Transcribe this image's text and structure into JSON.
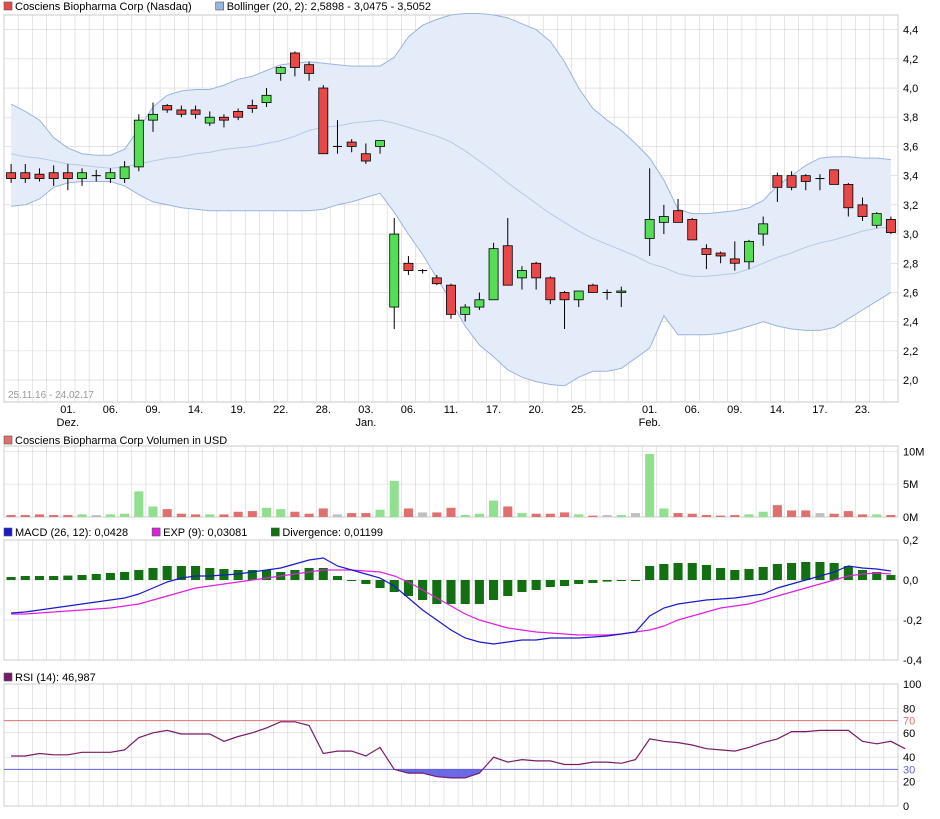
{
  "colors": {
    "up": "#55dd55",
    "down": "#e84848",
    "vol_up": "#90e090",
    "vol_down": "#e07070",
    "vol_neutral": "#c0c0c0",
    "band_fill": "#e4ecfa",
    "band_line": "#9bb4dc",
    "macd": "#1a1acc",
    "exp": "#e020e0",
    "divergence": "#127012",
    "rsi": "#7a1a6a",
    "rsi_70": "#e07070",
    "rsi_30": "#6060e0",
    "rsi_fill": "#5050e0",
    "grid": "#d4d4d4"
  },
  "chart_data": [
    {
      "type": "candlestick",
      "legend": [
        {
          "label": "Cosciens Biopharma Corp (Nasdaq)",
          "color": "#e84848"
        },
        {
          "label": "Bollinger (20, 2): 2,5898 - 3,0475 - 3,5052",
          "color": "#9bb4dc"
        }
      ],
      "date_range": "25.11.16 - 24.02.17",
      "ylim": [
        1.85,
        4.5
      ],
      "y_ticks": [
        "2,0",
        "2,2",
        "2,4",
        "2,6",
        "2,8",
        "3,0",
        "3,2",
        "3,4",
        "3,6",
        "3,8",
        "4,0",
        "4,2",
        "4,4"
      ],
      "x_ticks": [
        {
          "i": 4,
          "label": "01.",
          "sub": "Dez."
        },
        {
          "i": 7,
          "label": "06."
        },
        {
          "i": 10,
          "label": "09."
        },
        {
          "i": 13,
          "label": "14."
        },
        {
          "i": 16,
          "label": "19."
        },
        {
          "i": 19,
          "label": "22."
        },
        {
          "i": 22,
          "label": "28."
        },
        {
          "i": 25,
          "label": "03.",
          "sub": "Jan."
        },
        {
          "i": 28,
          "label": "06."
        },
        {
          "i": 31,
          "label": "11."
        },
        {
          "i": 34,
          "label": "17."
        },
        {
          "i": 37,
          "label": "20."
        },
        {
          "i": 40,
          "label": "25."
        },
        {
          "i": 45,
          "label": "01.",
          "sub": "Feb."
        },
        {
          "i": 48,
          "label": "06."
        },
        {
          "i": 51,
          "label": "09."
        },
        {
          "i": 54,
          "label": "14."
        },
        {
          "i": 57,
          "label": "17."
        },
        {
          "i": 60,
          "label": "23."
        }
      ],
      "ohlc": [
        [
          3.42,
          3.48,
          3.35,
          3.38
        ],
        [
          3.42,
          3.48,
          3.35,
          3.38
        ],
        [
          3.41,
          3.45,
          3.36,
          3.38
        ],
        [
          3.42,
          3.47,
          3.33,
          3.38
        ],
        [
          3.42,
          3.48,
          3.3,
          3.38
        ],
        [
          3.38,
          3.45,
          3.33,
          3.42
        ],
        [
          3.4,
          3.44,
          3.36,
          3.4
        ],
        [
          3.38,
          3.45,
          3.35,
          3.42
        ],
        [
          3.38,
          3.5,
          3.35,
          3.46
        ],
        [
          3.46,
          3.82,
          3.43,
          3.78
        ],
        [
          3.78,
          3.9,
          3.7,
          3.82
        ],
        [
          3.88,
          3.89,
          3.83,
          3.85
        ],
        [
          3.85,
          3.88,
          3.8,
          3.82
        ],
        [
          3.85,
          3.88,
          3.79,
          3.82
        ],
        [
          3.76,
          3.84,
          3.74,
          3.8
        ],
        [
          3.8,
          3.82,
          3.73,
          3.78
        ],
        [
          3.84,
          3.86,
          3.78,
          3.8
        ],
        [
          3.88,
          3.92,
          3.83,
          3.86
        ],
        [
          3.9,
          4.0,
          3.87,
          3.95
        ],
        [
          4.1,
          4.15,
          4.05,
          4.14
        ],
        [
          4.24,
          4.25,
          4.08,
          4.14
        ],
        [
          4.16,
          4.18,
          4.05,
          4.1
        ],
        [
          4.0,
          4.02,
          3.55,
          3.55
        ],
        [
          3.6,
          3.78,
          3.55,
          3.6
        ],
        [
          3.63,
          3.65,
          3.56,
          3.6
        ],
        [
          3.55,
          3.62,
          3.48,
          3.5
        ],
        [
          3.6,
          3.64,
          3.55,
          3.64
        ],
        [
          2.5,
          3.11,
          2.35,
          3.0
        ],
        [
          2.8,
          2.85,
          2.72,
          2.75
        ],
        [
          2.75,
          2.76,
          2.73,
          2.75
        ],
        [
          2.7,
          2.72,
          2.65,
          2.66
        ],
        [
          2.65,
          2.66,
          2.42,
          2.45
        ],
        [
          2.45,
          2.52,
          2.4,
          2.5
        ],
        [
          2.5,
          2.6,
          2.48,
          2.55
        ],
        [
          2.55,
          2.94,
          2.55,
          2.9
        ],
        [
          2.92,
          3.11,
          2.65,
          2.65
        ],
        [
          2.7,
          2.78,
          2.62,
          2.75
        ],
        [
          2.8,
          2.81,
          2.62,
          2.7
        ],
        [
          2.7,
          2.71,
          2.52,
          2.55
        ],
        [
          2.6,
          2.61,
          2.35,
          2.55
        ],
        [
          2.55,
          2.61,
          2.5,
          2.61
        ],
        [
          2.65,
          2.66,
          2.6,
          2.6
        ],
        [
          2.6,
          2.62,
          2.55,
          2.6
        ],
        [
          2.6,
          2.64,
          2.5,
          2.61
        ],
        null,
        [
          2.97,
          3.45,
          2.85,
          3.1
        ],
        [
          3.08,
          3.2,
          3.0,
          3.12
        ],
        [
          3.16,
          3.24,
          3.08,
          3.08
        ],
        [
          3.1,
          3.11,
          2.96,
          2.96
        ],
        [
          2.9,
          2.93,
          2.76,
          2.86
        ],
        [
          2.87,
          2.88,
          2.8,
          2.85
        ],
        [
          2.83,
          2.95,
          2.75,
          2.8
        ],
        [
          2.81,
          2.96,
          2.76,
          2.95
        ],
        [
          3.0,
          3.12,
          2.92,
          3.07
        ],
        [
          3.4,
          3.42,
          3.22,
          3.32
        ],
        [
          3.4,
          3.43,
          3.3,
          3.32
        ],
        [
          3.4,
          3.41,
          3.3,
          3.36
        ],
        [
          3.38,
          3.41,
          3.3,
          3.38
        ],
        [
          3.44,
          3.44,
          3.34,
          3.34
        ],
        [
          3.34,
          3.35,
          3.12,
          3.18
        ],
        [
          3.2,
          3.25,
          3.09,
          3.12
        ],
        [
          3.06,
          3.15,
          3.04,
          3.14
        ],
        [
          3.1,
          3.12,
          3.0,
          3.01
        ]
      ],
      "bollinger_upper": [
        3.89,
        3.84,
        3.78,
        3.66,
        3.59,
        3.55,
        3.54,
        3.54,
        3.58,
        3.72,
        3.87,
        3.95,
        3.98,
        3.99,
        3.99,
        4.02,
        4.06,
        4.08,
        4.12,
        4.16,
        4.17,
        4.18,
        4.17,
        4.16,
        4.15,
        4.15,
        4.15,
        4.21,
        4.35,
        4.43,
        4.47,
        4.5,
        4.51,
        4.51,
        4.5,
        4.48,
        4.44,
        4.4,
        4.32,
        4.18,
        4.0,
        3.86,
        3.78,
        3.71,
        3.62,
        3.52,
        3.37,
        3.17,
        3.14,
        3.14,
        3.15,
        3.16,
        3.18,
        3.23,
        3.33,
        3.4,
        3.47,
        3.52,
        3.53,
        3.53,
        3.52,
        3.52,
        3.51
      ],
      "bollinger_middle": [
        3.55,
        3.53,
        3.52,
        3.5,
        3.48,
        3.47,
        3.46,
        3.45,
        3.46,
        3.48,
        3.5,
        3.52,
        3.53,
        3.55,
        3.56,
        3.58,
        3.59,
        3.6,
        3.62,
        3.64,
        3.67,
        3.71,
        3.73,
        3.74,
        3.76,
        3.77,
        3.78,
        3.76,
        3.73,
        3.7,
        3.67,
        3.63,
        3.57,
        3.5,
        3.43,
        3.35,
        3.28,
        3.21,
        3.14,
        3.08,
        3.02,
        2.97,
        2.93,
        2.89,
        2.85,
        2.8,
        2.77,
        2.73,
        2.71,
        2.71,
        2.72,
        2.73,
        2.76,
        2.8,
        2.84,
        2.87,
        2.91,
        2.94,
        2.96,
        2.99,
        3.02,
        3.04,
        3.05
      ],
      "bollinger_lower": [
        3.19,
        3.2,
        3.24,
        3.32,
        3.35,
        3.36,
        3.36,
        3.36,
        3.33,
        3.27,
        3.22,
        3.2,
        3.18,
        3.17,
        3.16,
        3.16,
        3.16,
        3.16,
        3.16,
        3.16,
        3.16,
        3.16,
        3.17,
        3.2,
        3.22,
        3.25,
        3.28,
        3.15,
        3.0,
        2.86,
        2.7,
        2.54,
        2.37,
        2.24,
        2.16,
        2.07,
        2.02,
        1.99,
        1.97,
        1.96,
        2.02,
        2.06,
        2.06,
        2.08,
        2.15,
        2.22,
        2.44,
        2.31,
        2.31,
        2.31,
        2.32,
        2.34,
        2.37,
        2.4,
        2.37,
        2.35,
        2.34,
        2.34,
        2.36,
        2.42,
        2.48,
        2.54,
        2.6
      ]
    },
    {
      "type": "bar",
      "legend": [
        {
          "label": "Cosciens Biopharma Corp Volumen in USD",
          "color": "#e07070"
        }
      ],
      "ylim": [
        0,
        10.8
      ],
      "y_ticks": [
        {
          "v": 0,
          "label": "0M"
        },
        {
          "v": 5,
          "label": "5M"
        },
        {
          "v": 10,
          "label": "10M"
        }
      ],
      "volume_millions": [
        0.3,
        0.3,
        0.4,
        0.3,
        0.3,
        0.4,
        0.3,
        0.4,
        0.5,
        3.9,
        1.6,
        1.2,
        0.5,
        0.4,
        0.4,
        0.4,
        0.8,
        0.9,
        1.4,
        1.2,
        0.8,
        0.5,
        1.3,
        0.4,
        0.6,
        0.6,
        1.1,
        5.5,
        1.3,
        0.7,
        0.7,
        1.4,
        0.3,
        0.5,
        2.5,
        1.6,
        0.6,
        0.5,
        0.5,
        0.7,
        0.4,
        0.2,
        0.3,
        0.3,
        0.6,
        9.6,
        1.3,
        0.6,
        0.5,
        0.3,
        0.2,
        0.3,
        0.4,
        0.8,
        1.8,
        1.0,
        1.0,
        0.6,
        0.5,
        0.9,
        0.4,
        0.4,
        0.3
      ]
    },
    {
      "type": "bar+line",
      "legend": [
        {
          "label": "MACD (26, 12): 0,0428",
          "color": "#1a1acc"
        },
        {
          "label": "EXP (9): 0,03081",
          "color": "#e020e0"
        },
        {
          "label": "Divergence: 0,01199",
          "color": "#127012"
        }
      ],
      "ylim": [
        -0.4,
        0.2
      ],
      "y_ticks": [
        {
          "v": 0.2,
          "label": "0,2"
        },
        {
          "v": 0.0,
          "label": "0,0"
        },
        {
          "v": -0.2,
          "label": "-0,2"
        },
        {
          "v": -0.4,
          "label": "-0,4"
        }
      ],
      "macd": [
        -0.165,
        -0.16,
        -0.15,
        -0.14,
        -0.13,
        -0.12,
        -0.11,
        -0.1,
        -0.09,
        -0.07,
        -0.04,
        -0.01,
        0.01,
        0.02,
        0.02,
        0.025,
        0.03,
        0.04,
        0.05,
        0.06,
        0.08,
        0.1,
        0.11,
        0.07,
        0.05,
        0.03,
        0.01,
        -0.03,
        -0.09,
        -0.15,
        -0.2,
        -0.25,
        -0.29,
        -0.31,
        -0.32,
        -0.31,
        -0.3,
        -0.3,
        -0.29,
        -0.29,
        -0.29,
        -0.285,
        -0.28,
        -0.27,
        -0.26,
        -0.18,
        -0.14,
        -0.12,
        -0.11,
        -0.1,
        -0.095,
        -0.09,
        -0.08,
        -0.07,
        -0.04,
        -0.02,
        0.0,
        0.02,
        0.04,
        0.07,
        0.06,
        0.055,
        0.045
      ],
      "exp": [
        -0.17,
        -0.17,
        -0.165,
        -0.16,
        -0.155,
        -0.15,
        -0.145,
        -0.14,
        -0.13,
        -0.12,
        -0.1,
        -0.08,
        -0.06,
        -0.04,
        -0.03,
        -0.02,
        -0.01,
        0.0,
        0.01,
        0.02,
        0.03,
        0.04,
        0.05,
        0.05,
        0.05,
        0.045,
        0.04,
        0.02,
        -0.01,
        -0.05,
        -0.09,
        -0.13,
        -0.17,
        -0.2,
        -0.22,
        -0.24,
        -0.25,
        -0.26,
        -0.265,
        -0.27,
        -0.275,
        -0.275,
        -0.275,
        -0.27,
        -0.26,
        -0.25,
        -0.23,
        -0.2,
        -0.18,
        -0.16,
        -0.14,
        -0.13,
        -0.12,
        -0.1,
        -0.08,
        -0.06,
        -0.04,
        -0.02,
        0.0,
        0.02,
        0.03,
        0.035,
        0.03
      ],
      "divergence": [
        0.015,
        0.02,
        0.02,
        0.02,
        0.022,
        0.025,
        0.03,
        0.035,
        0.04,
        0.05,
        0.06,
        0.07,
        0.07,
        0.07,
        0.06,
        0.055,
        0.05,
        0.05,
        0.05,
        0.04,
        0.05,
        0.06,
        0.06,
        0.02,
        0.0,
        -0.02,
        -0.04,
        -0.06,
        -0.08,
        -0.1,
        -0.12,
        -0.12,
        -0.12,
        -0.12,
        -0.1,
        -0.08,
        -0.06,
        -0.05,
        -0.035,
        -0.03,
        -0.02,
        -0.015,
        -0.008,
        -0.005,
        -0.003,
        0.07,
        0.08,
        0.085,
        0.085,
        0.075,
        0.06,
        0.05,
        0.055,
        0.065,
        0.08,
        0.085,
        0.09,
        0.09,
        0.085,
        0.07,
        0.05,
        0.04,
        0.025
      ]
    },
    {
      "type": "line",
      "legend": [
        {
          "label": "RSI (14): 46,987",
          "color": "#7a1a6a"
        }
      ],
      "ylim": [
        0,
        100
      ],
      "y_ticks": [
        {
          "v": 100,
          "label": "100"
        },
        {
          "v": 80,
          "label": "80"
        },
        {
          "v": 70,
          "label": "70",
          "color": "#e07070"
        },
        {
          "v": 60,
          "label": "60"
        },
        {
          "v": 40,
          "label": "40"
        },
        {
          "v": 30,
          "label": "30",
          "color": "#6060e0"
        },
        {
          "v": 20,
          "label": "20"
        },
        {
          "v": 0,
          "label": "0"
        }
      ],
      "levels": [
        70,
        30
      ],
      "rsi": [
        41,
        41,
        43,
        42,
        42,
        44,
        44,
        44,
        46,
        56,
        60,
        62,
        59,
        59,
        59,
        53,
        57,
        60,
        64,
        69,
        69,
        66,
        43,
        45,
        45,
        41,
        48,
        30,
        27,
        27,
        24,
        23,
        23,
        27,
        40,
        36,
        38,
        37,
        37,
        34,
        34,
        36,
        36,
        35,
        38,
        55,
        53,
        52,
        50,
        47,
        46,
        45,
        48,
        52,
        55,
        61,
        61,
        62,
        62,
        62,
        53,
        51,
        53,
        47
      ]
    }
  ]
}
